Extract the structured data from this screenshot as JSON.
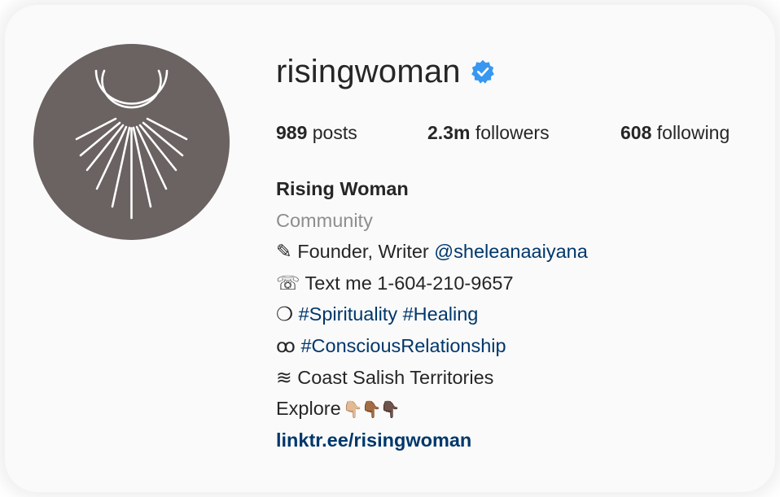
{
  "profile": {
    "username": "risingwoman",
    "verified_icon": "verified-badge-icon",
    "avatar_icon": "crescent-moon-rays-icon",
    "colors": {
      "avatar_bg": "#6b6262",
      "verified": "#3897f0",
      "link": "#00376b",
      "category": "#8e8e8e"
    }
  },
  "stats": {
    "posts_count": "989",
    "posts_label": " posts",
    "followers_count": "2.3m",
    "followers_label": " followers",
    "following_count": "608",
    "following_label": " following"
  },
  "bio": {
    "name": "Rising Woman",
    "category": "Community",
    "line1_icon": "✎",
    "line1_text": " Founder, Writer ",
    "line1_mention": "@sheleanaaiyana",
    "line2_icon": "☏",
    "line2_text": " Text me 1-604-210-9657",
    "line3_icon": "❍",
    "line3_tags": "#Spirituality #Healing",
    "line4_icon": "ꝏ",
    "line4_tag": "#ConsciousRelationship",
    "line5_icon": "≋",
    "line5_text": " Coast Salish Territories",
    "line6_text": "Explore",
    "line6_hands": "👇🏼👇🏾👇🏿",
    "website": "linktr.ee/risingwoman"
  }
}
